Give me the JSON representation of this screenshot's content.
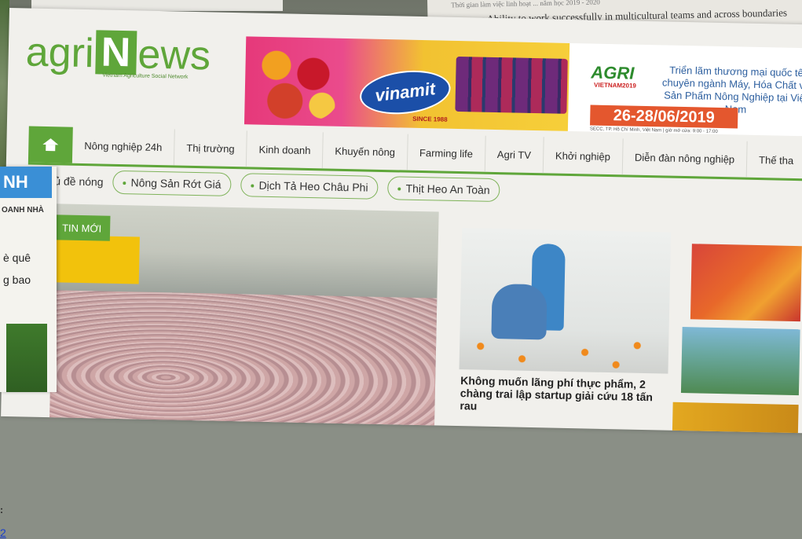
{
  "paper_top_right": {
    "small_line": "Thời gian làm việc linh hoạt ... năm học 2019 - 2020",
    "bullet_text": "Ability to work successfully in multicultural teams and across boundaries"
  },
  "logo": {
    "part1": "agri",
    "part2": "N",
    "part3": "ews",
    "tagline": "Vietnam Agriculture Social Network"
  },
  "banner": {
    "brand": "vinamit",
    "since": "SINCE 1988",
    "event_logo": "AGRI",
    "event_logo_sub": "VIETNAM2019",
    "event_text": "Triển lãm thương mại quốc tế chuyên ngành Máy, Hóa Chất và Sản Phẩm Nông Nghiệp tại Việt Nam",
    "dates": "26-28/06/2019",
    "venue": "SECC, TP. Hồ Chí Minh, Việt Nam | giờ mở cửa: 9:00 - 17:00"
  },
  "nav": {
    "items": [
      "Nông nghiệp 24h",
      "Thị trường",
      "Kinh doanh",
      "Khuyến nông",
      "Farming life",
      "Agri TV",
      "Khởi nghiệp",
      "Diễn đàn nông nghiệp",
      "Thế tha"
    ]
  },
  "hot": {
    "label": "Chủ đề nóng",
    "tags": [
      "Nông Sản Rớt Giá",
      "Dịch Tả Heo Châu Phi",
      "Thịt Heo An Toàn"
    ]
  },
  "feature": {
    "badge": "TIN MỚI"
  },
  "card2": {
    "title": "Không muốn lãng phí thực phẩm, 2 chàng trai lập startup giải cứu 18 tấn rau"
  },
  "left_flyer": {
    "head": "NH",
    "sub": "OANH NHÀ",
    "line1": "è quê",
    "line2": "g bao",
    "colon": ":",
    "num": "2"
  }
}
